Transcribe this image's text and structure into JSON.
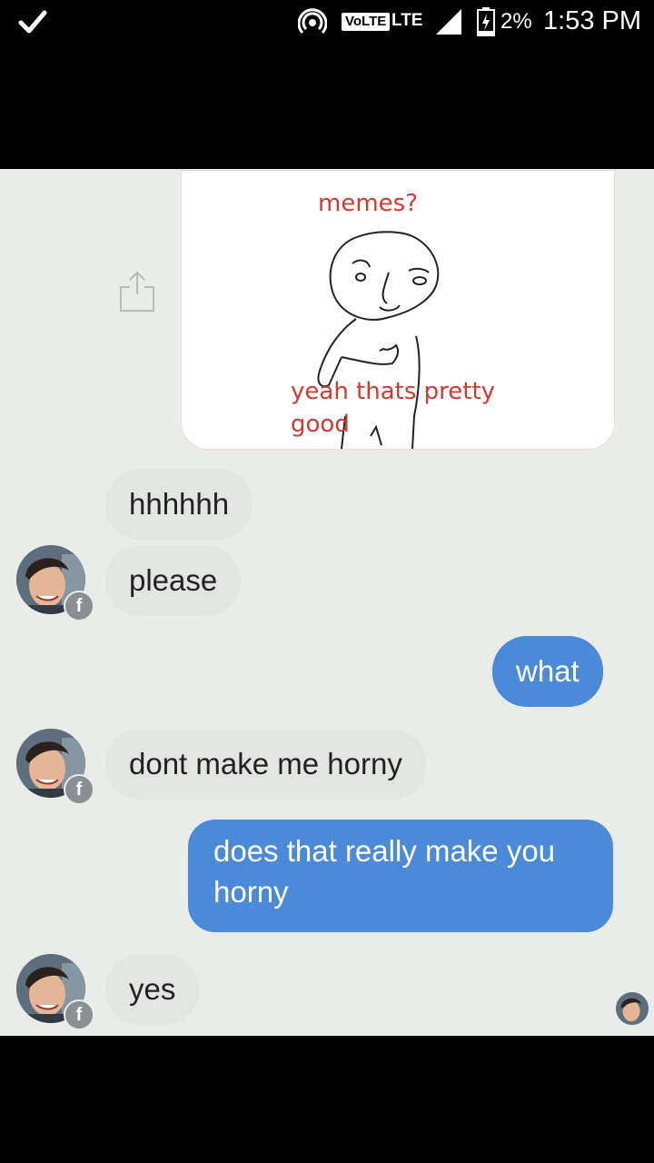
{
  "status_bar": {
    "volte": "VoLTE",
    "network": "LTE",
    "battery_percent": "2%",
    "time": "1:53 PM",
    "icons": [
      "check-icon",
      "hotspot-icon",
      "signal-icon",
      "battery-charging-icon"
    ]
  },
  "meme": {
    "top_text": "memes?",
    "bottom_text": "yeah thats pretty good"
  },
  "messages": [
    {
      "from": "other",
      "text": "hhhhhh"
    },
    {
      "from": "other",
      "text": "please"
    },
    {
      "from": "me",
      "text": "what"
    },
    {
      "from": "other",
      "text": "dont make me horny"
    },
    {
      "from": "me",
      "text": "does that really make you horny"
    },
    {
      "from": "other",
      "text": "yes"
    }
  ],
  "badge_letter": "f",
  "colors": {
    "incoming_bubble": "#e2e5e1",
    "outgoing_bubble": "#4a8ad8",
    "chat_background": "#e9ece8",
    "meme_text": "#d03b2f"
  }
}
